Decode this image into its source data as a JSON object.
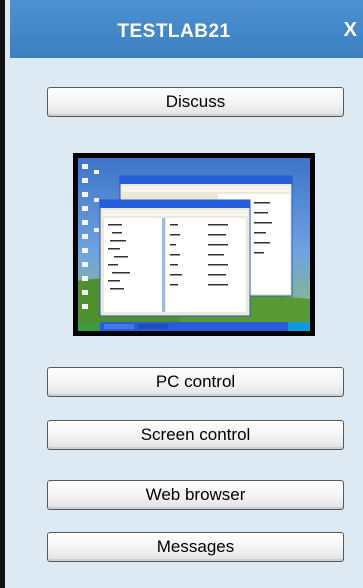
{
  "window": {
    "title": "TESTLAB21",
    "close_glyph": "X"
  },
  "buttons": {
    "discuss": "Discuss",
    "pc_control": "PC control",
    "screen_control": "Screen control",
    "web_browser": "Web browser",
    "messages": "Messages"
  },
  "colors": {
    "titlebar": "#4a8ccb",
    "panel_background": "#dde9f3",
    "left_border": "#111111"
  }
}
